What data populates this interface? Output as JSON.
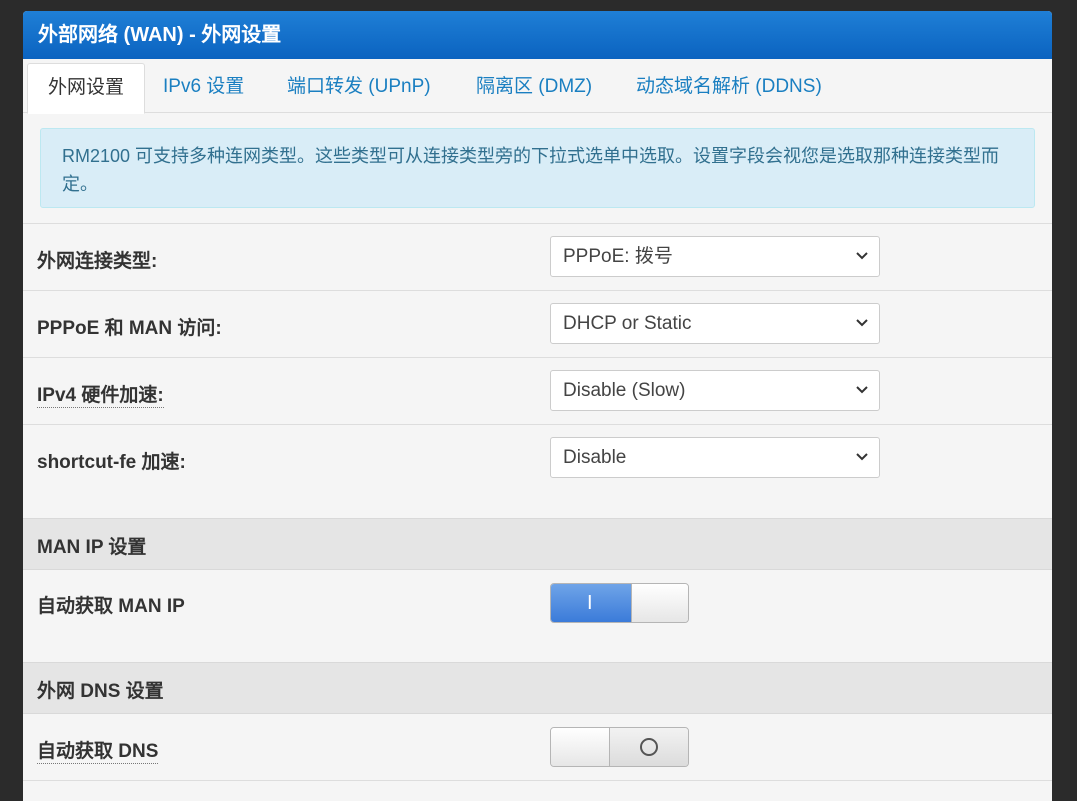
{
  "header": {
    "title": "外部网络 (WAN) - 外网设置"
  },
  "tabs": [
    {
      "label": "外网设置",
      "active": true
    },
    {
      "label": "IPv6 设置",
      "active": false
    },
    {
      "label": "端口转发 (UPnP)",
      "active": false
    },
    {
      "label": "隔离区 (DMZ)",
      "active": false
    },
    {
      "label": "动态域名解析 (DDNS)",
      "active": false
    }
  ],
  "info": {
    "text": "RM2100 可支持多种连网类型。这些类型可从连接类型旁的下拉式选单中选取。设置字段会视您是选取那种连接类型而定。"
  },
  "settings": {
    "wan_type": {
      "label": "外网连接类型:",
      "value": "PPPoE: 拨号"
    },
    "pppoe_man": {
      "label": "PPPoE 和 MAN 访问:",
      "value": "DHCP or Static"
    },
    "ipv4_hw": {
      "label": "IPv4 硬件加速:",
      "value": "Disable (Slow)"
    },
    "shortcut_fe": {
      "label": "shortcut-fe 加速:",
      "value": "Disable"
    }
  },
  "man_ip": {
    "section_title": "MAN IP 设置",
    "auto_label": "自动获取 MAN IP",
    "auto_enabled": true,
    "on_glyph": "I"
  },
  "dns": {
    "section_title": "外网 DNS 设置",
    "auto_label": "自动获取 DNS",
    "auto_enabled": false,
    "off_glyph": "O"
  },
  "colors": {
    "header_blue": "#0b63c0",
    "tab_link": "#1a7fc1",
    "info_bg": "#d9edf7",
    "toggle_on": "#3b7bd9"
  }
}
